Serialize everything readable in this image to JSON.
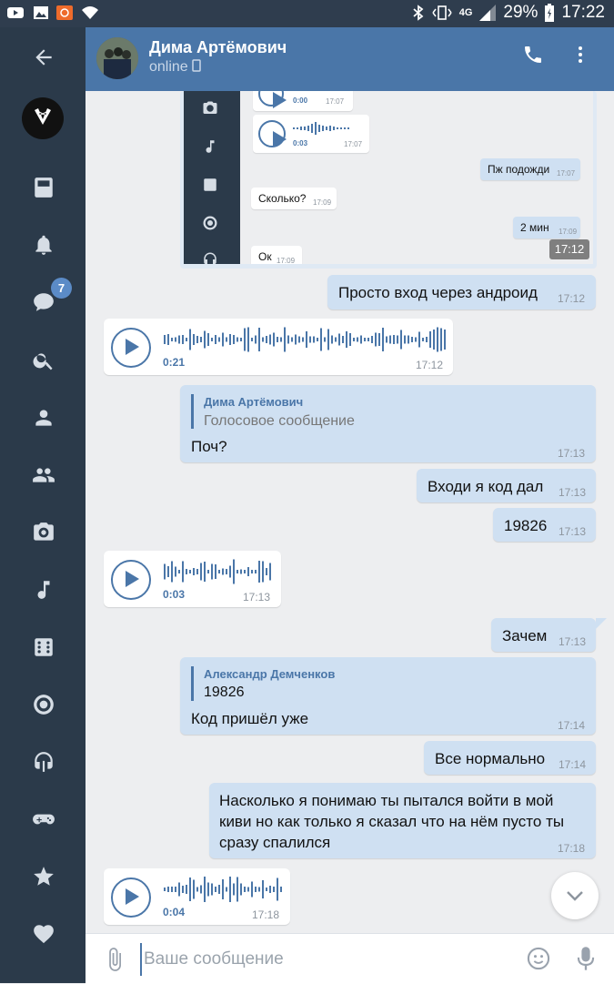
{
  "status_bar": {
    "battery": "29%",
    "time": "17:22",
    "network": "4G"
  },
  "header": {
    "title": "Дима Артёмович",
    "status": "online"
  },
  "sidebar": {
    "badge": "7"
  },
  "screenshot_preview": {
    "voice1": {
      "duration": "0:00",
      "time": "17:07"
    },
    "voice2": {
      "duration": "0:03",
      "time": "17:07"
    },
    "messages": [
      {
        "text": "Пж подожди",
        "time": "17:07"
      },
      {
        "text": "Сколько?",
        "time": "17:09"
      },
      {
        "text": "2 мин",
        "time": "17:09"
      },
      {
        "text": "Ок",
        "time": "17:09"
      }
    ],
    "overlay_time": "17:12"
  },
  "messages": [
    {
      "text": "Просто вход через андроид",
      "time": "17:12"
    },
    {
      "voice_duration": "0:21",
      "time": "17:12"
    },
    {
      "quote_author": "Дима Артёмович",
      "quote_text": "Голосовое сообщение",
      "text": "Поч?",
      "time": "17:13"
    },
    {
      "text": "Входи я код дал",
      "time": "17:13"
    },
    {
      "text": "19826",
      "time": "17:13"
    },
    {
      "voice_duration": "0:03",
      "time": "17:13"
    },
    {
      "text": "Зачем",
      "time": "17:13"
    },
    {
      "quote_author": "Александр Демченков",
      "quote_text": "19826",
      "text": "Код пришёл уже",
      "time": "17:14"
    },
    {
      "text": "Все нормально",
      "time": "17:14"
    },
    {
      "text_lines": [
        "Насколько я понимаю ты пытался войти в мой",
        "киви но как только я сказал что на нём пусто ты",
        "сразу спалился"
      ],
      "time": "17:18"
    },
    {
      "voice_duration": "0:04",
      "time": "17:18"
    }
  ],
  "input": {
    "placeholder": "Ваше сообщение"
  },
  "colors": {
    "header": "#4a76a8",
    "sidebar": "#2b3a4a",
    "outgoing_bubble": "#cfe0f2",
    "incoming_bubble": "#ffffff"
  }
}
